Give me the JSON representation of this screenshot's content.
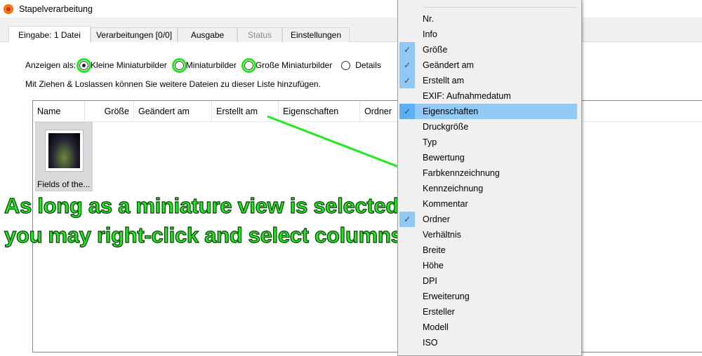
{
  "window": {
    "title": "Stapelverarbeitung"
  },
  "tabs": [
    {
      "label": "Eingabe: 1 Datei"
    },
    {
      "label": "Verarbeitungen [0/0]"
    },
    {
      "label": "Ausgabe"
    },
    {
      "label": "Status"
    },
    {
      "label": "Einstellungen"
    }
  ],
  "view": {
    "label": "Anzeigen als:",
    "options": [
      {
        "label": "Kleine Miniaturbilder",
        "selected": true
      },
      {
        "label": "Miniaturbilder",
        "selected": false
      },
      {
        "label": "Große Miniaturbilder",
        "selected": false
      },
      {
        "label": "Details",
        "selected": false
      }
    ]
  },
  "hint": "Mit Ziehen & Loslassen können Sie weitere Dateien zu dieser Liste hinzufügen.",
  "columns": [
    "Name",
    "Größe",
    "Geändert am",
    "Erstellt am",
    "Eigenschaften",
    "Ordner"
  ],
  "files": [
    {
      "name": "Fields of the..."
    }
  ],
  "annotation": {
    "line1": "As long as a miniature view is selected,",
    "line2": "you may right-click and select columns.",
    "color": "#22e81e"
  },
  "menu": {
    "items": [
      {
        "label": "Nr.",
        "checked": false
      },
      {
        "label": "Info",
        "checked": false
      },
      {
        "label": "Größe",
        "checked": true
      },
      {
        "label": "Geändert am",
        "checked": true
      },
      {
        "label": "Erstellt am",
        "checked": true
      },
      {
        "label": "EXIF: Aufnahmedatum",
        "checked": false
      },
      {
        "label": "Eigenschaften",
        "checked": true,
        "hover": true
      },
      {
        "label": "Druckgröße",
        "checked": false
      },
      {
        "label": "Typ",
        "checked": false
      },
      {
        "label": "Bewertung",
        "checked": false
      },
      {
        "label": "Farbkennzeichnung",
        "checked": false
      },
      {
        "label": "Kennzeichnung",
        "checked": false
      },
      {
        "label": "Kommentar",
        "checked": false
      },
      {
        "label": "Ordner",
        "checked": true
      },
      {
        "label": "Verhältnis",
        "checked": false
      },
      {
        "label": "Breite",
        "checked": false
      },
      {
        "label": "Höhe",
        "checked": false
      },
      {
        "label": "DPI",
        "checked": false
      },
      {
        "label": "Erweiterung",
        "checked": false
      },
      {
        "label": "Ersteller",
        "checked": false
      },
      {
        "label": "Modell",
        "checked": false
      },
      {
        "label": "ISO",
        "checked": false
      }
    ]
  }
}
